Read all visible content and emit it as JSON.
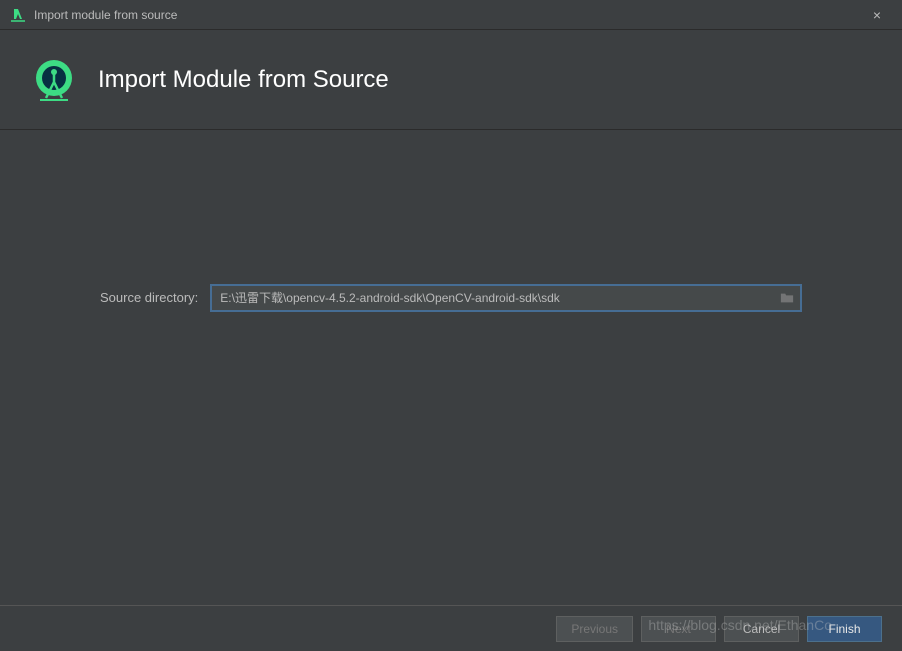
{
  "titlebar": {
    "title": "Import module from source",
    "close": "×"
  },
  "header": {
    "title": "Import Module from Source"
  },
  "form": {
    "source_label": "Source directory:",
    "source_value": "E:\\迅雷下载\\opencv-4.5.2-android-sdk\\OpenCV-android-sdk\\sdk"
  },
  "footer": {
    "previous": "Previous",
    "next": "Next",
    "cancel": "Cancel",
    "finish": "Finish"
  },
  "watermark": "https://blog.csdn.net/EthanCo"
}
